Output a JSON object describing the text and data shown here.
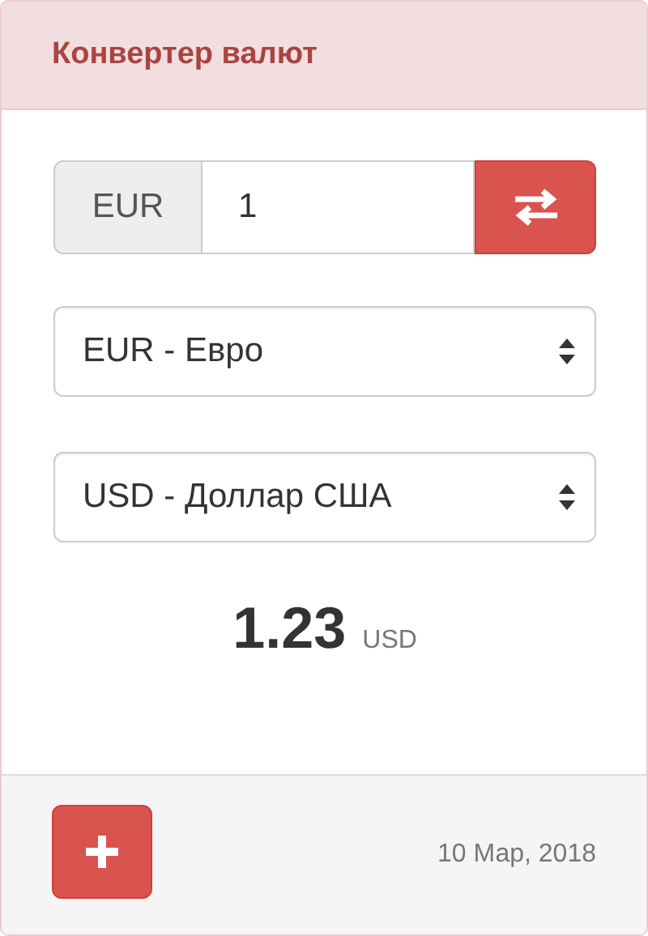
{
  "panel": {
    "title": "Конвертер валют"
  },
  "amount": {
    "currency": "EUR",
    "value": "1"
  },
  "selects": [
    {
      "value": "EUR - Евро"
    },
    {
      "value": "USD - Доллар США"
    }
  ],
  "result": {
    "amount": "1.23",
    "currency": "USD"
  },
  "footer": {
    "date": "10 Мар, 2018"
  }
}
